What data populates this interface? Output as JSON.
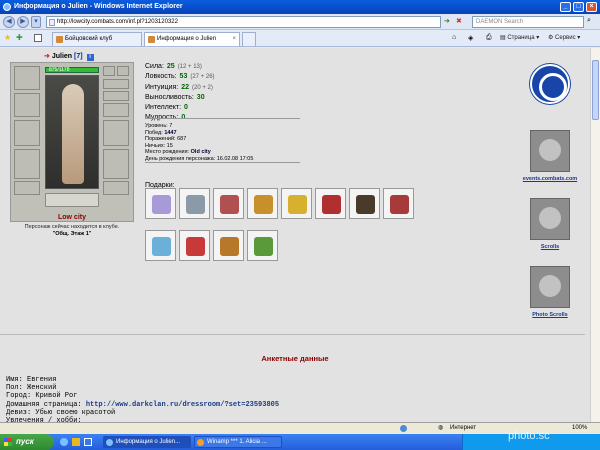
{
  "window": {
    "title": "Информация о Julien - Windows Internet Explorer"
  },
  "address": {
    "url": "http://lowcity.combats.com/inf.pl?1203120322",
    "search_placeholder": "DAEMON Search"
  },
  "tabs": [
    {
      "label": "Бойцовский клуб"
    },
    {
      "label": "Информация о Julien"
    }
  ],
  "commands": {
    "page": "Страница",
    "service": "Сервис"
  },
  "character": {
    "name": "Julien",
    "level": "[7]",
    "info_icon": "i",
    "hp": "875/1178",
    "city": "Low city",
    "location_text": "Персонаж сейчас находится в клубе.",
    "room": "\"Общ. Этаж 1\""
  },
  "stats": [
    {
      "label": "Сила:",
      "value": "25",
      "extra": "(12 + 13)"
    },
    {
      "label": "Ловкость:",
      "value": "53",
      "extra": "(27 + 26)"
    },
    {
      "label": "Интуиция:",
      "value": "22",
      "extra": "(20 + 2)"
    },
    {
      "label": "Выносливость:",
      "value": "30",
      "extra": ""
    },
    {
      "label": "Интеллект:",
      "value": "0",
      "extra": ""
    },
    {
      "label": "Мудрость:",
      "value": "0",
      "extra": ""
    }
  ],
  "record": {
    "level": "Уровень: 7",
    "wins_label": "Побед: ",
    "wins": "1447",
    "losses": "Поражений: 687",
    "draws": "Ничьих: 15",
    "birthplace_label": "Место рождения: ",
    "birthplace": "Old city",
    "birthday": "День рождения персонажа: 16.02.08 17:05"
  },
  "gifts_label": "Подарки:",
  "gifts_row1_colors": [
    "#a89ad8",
    "#8a9aa8",
    "#b05050",
    "#c8902a",
    "#d8b030",
    "#b03030",
    "#4a3a2a",
    "#a83a3a"
  ],
  "gifts_row2_colors": [
    "#6ab0d8",
    "#c83a3a",
    "#b8782a",
    "#5a9a3a"
  ],
  "banners": [
    {
      "label": "events.combats.com"
    },
    {
      "label": "Scrolls"
    },
    {
      "label": "Photo Scrolls"
    }
  ],
  "profile": {
    "title": "Анкетные данные",
    "name": "Имя: Евгения",
    "gender": "Пол: Женский",
    "city": "Город: Кривой Рог",
    "homepage_label": "Домашняя страница: ",
    "homepage": "http://www.darkclan.ru/dressroom/?set=23593805",
    "motto": "Девиз: Убью своею красотой",
    "hobby": "Увлечения / хобби:"
  },
  "statusbar": {
    "zone": "Интернет",
    "zoom": "100%"
  },
  "taskbar": {
    "start": "пуск",
    "tasks": [
      {
        "label": "Информация о Julien..."
      },
      {
        "label": "Winamp *** 1. Alicia ..."
      }
    ]
  },
  "watermark": "photo.sc",
  "colors": {
    "titlebar": "#0a5ee0",
    "heading": "#880000",
    "link": "#1a3a8a",
    "stat_value": "#006600"
  }
}
